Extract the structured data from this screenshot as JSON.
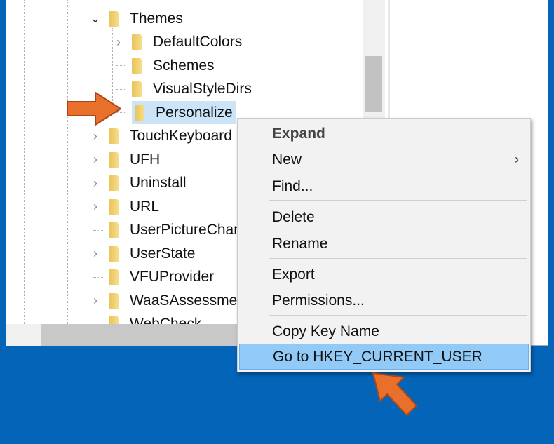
{
  "tree": {
    "items": [
      {
        "label": "Themes",
        "level": 0,
        "expander": "expanded"
      },
      {
        "label": "DefaultColors",
        "level": 1,
        "expander": "collapsed"
      },
      {
        "label": "Schemes",
        "level": 1,
        "expander": "none"
      },
      {
        "label": "VisualStyleDirs",
        "level": 1,
        "expander": "none"
      },
      {
        "label": "Personalize",
        "level": 1,
        "expander": "none",
        "selected": true
      },
      {
        "label": "TouchKeyboard",
        "level": 0,
        "expander": "collapsed"
      },
      {
        "label": "UFH",
        "level": 0,
        "expander": "collapsed"
      },
      {
        "label": "Uninstall",
        "level": 0,
        "expander": "collapsed"
      },
      {
        "label": "URL",
        "level": 0,
        "expander": "collapsed"
      },
      {
        "label": "UserPictureChange",
        "level": 0,
        "expander": "none"
      },
      {
        "label": "UserState",
        "level": 0,
        "expander": "collapsed"
      },
      {
        "label": "VFUProvider",
        "level": 0,
        "expander": "none"
      },
      {
        "label": "WaaSAssessment",
        "level": 0,
        "expander": "collapsed"
      },
      {
        "label": "WebCheck",
        "level": 0,
        "expander": "none"
      }
    ]
  },
  "context_menu": {
    "items": [
      {
        "label": "Expand",
        "bold": true
      },
      {
        "label": "New",
        "submenu": true
      },
      {
        "label": "Find..."
      },
      {
        "label": "Delete"
      },
      {
        "label": "Rename"
      },
      {
        "label": "Export"
      },
      {
        "label": "Permissions..."
      },
      {
        "label": "Copy Key Name"
      },
      {
        "label": "Go to HKEY_CURRENT_USER",
        "highlighted": true
      }
    ]
  },
  "colors": {
    "background": "#0364b8",
    "highlight": "#91c9f7",
    "selection": "#cce4f7",
    "arrow": "#e8702a"
  }
}
